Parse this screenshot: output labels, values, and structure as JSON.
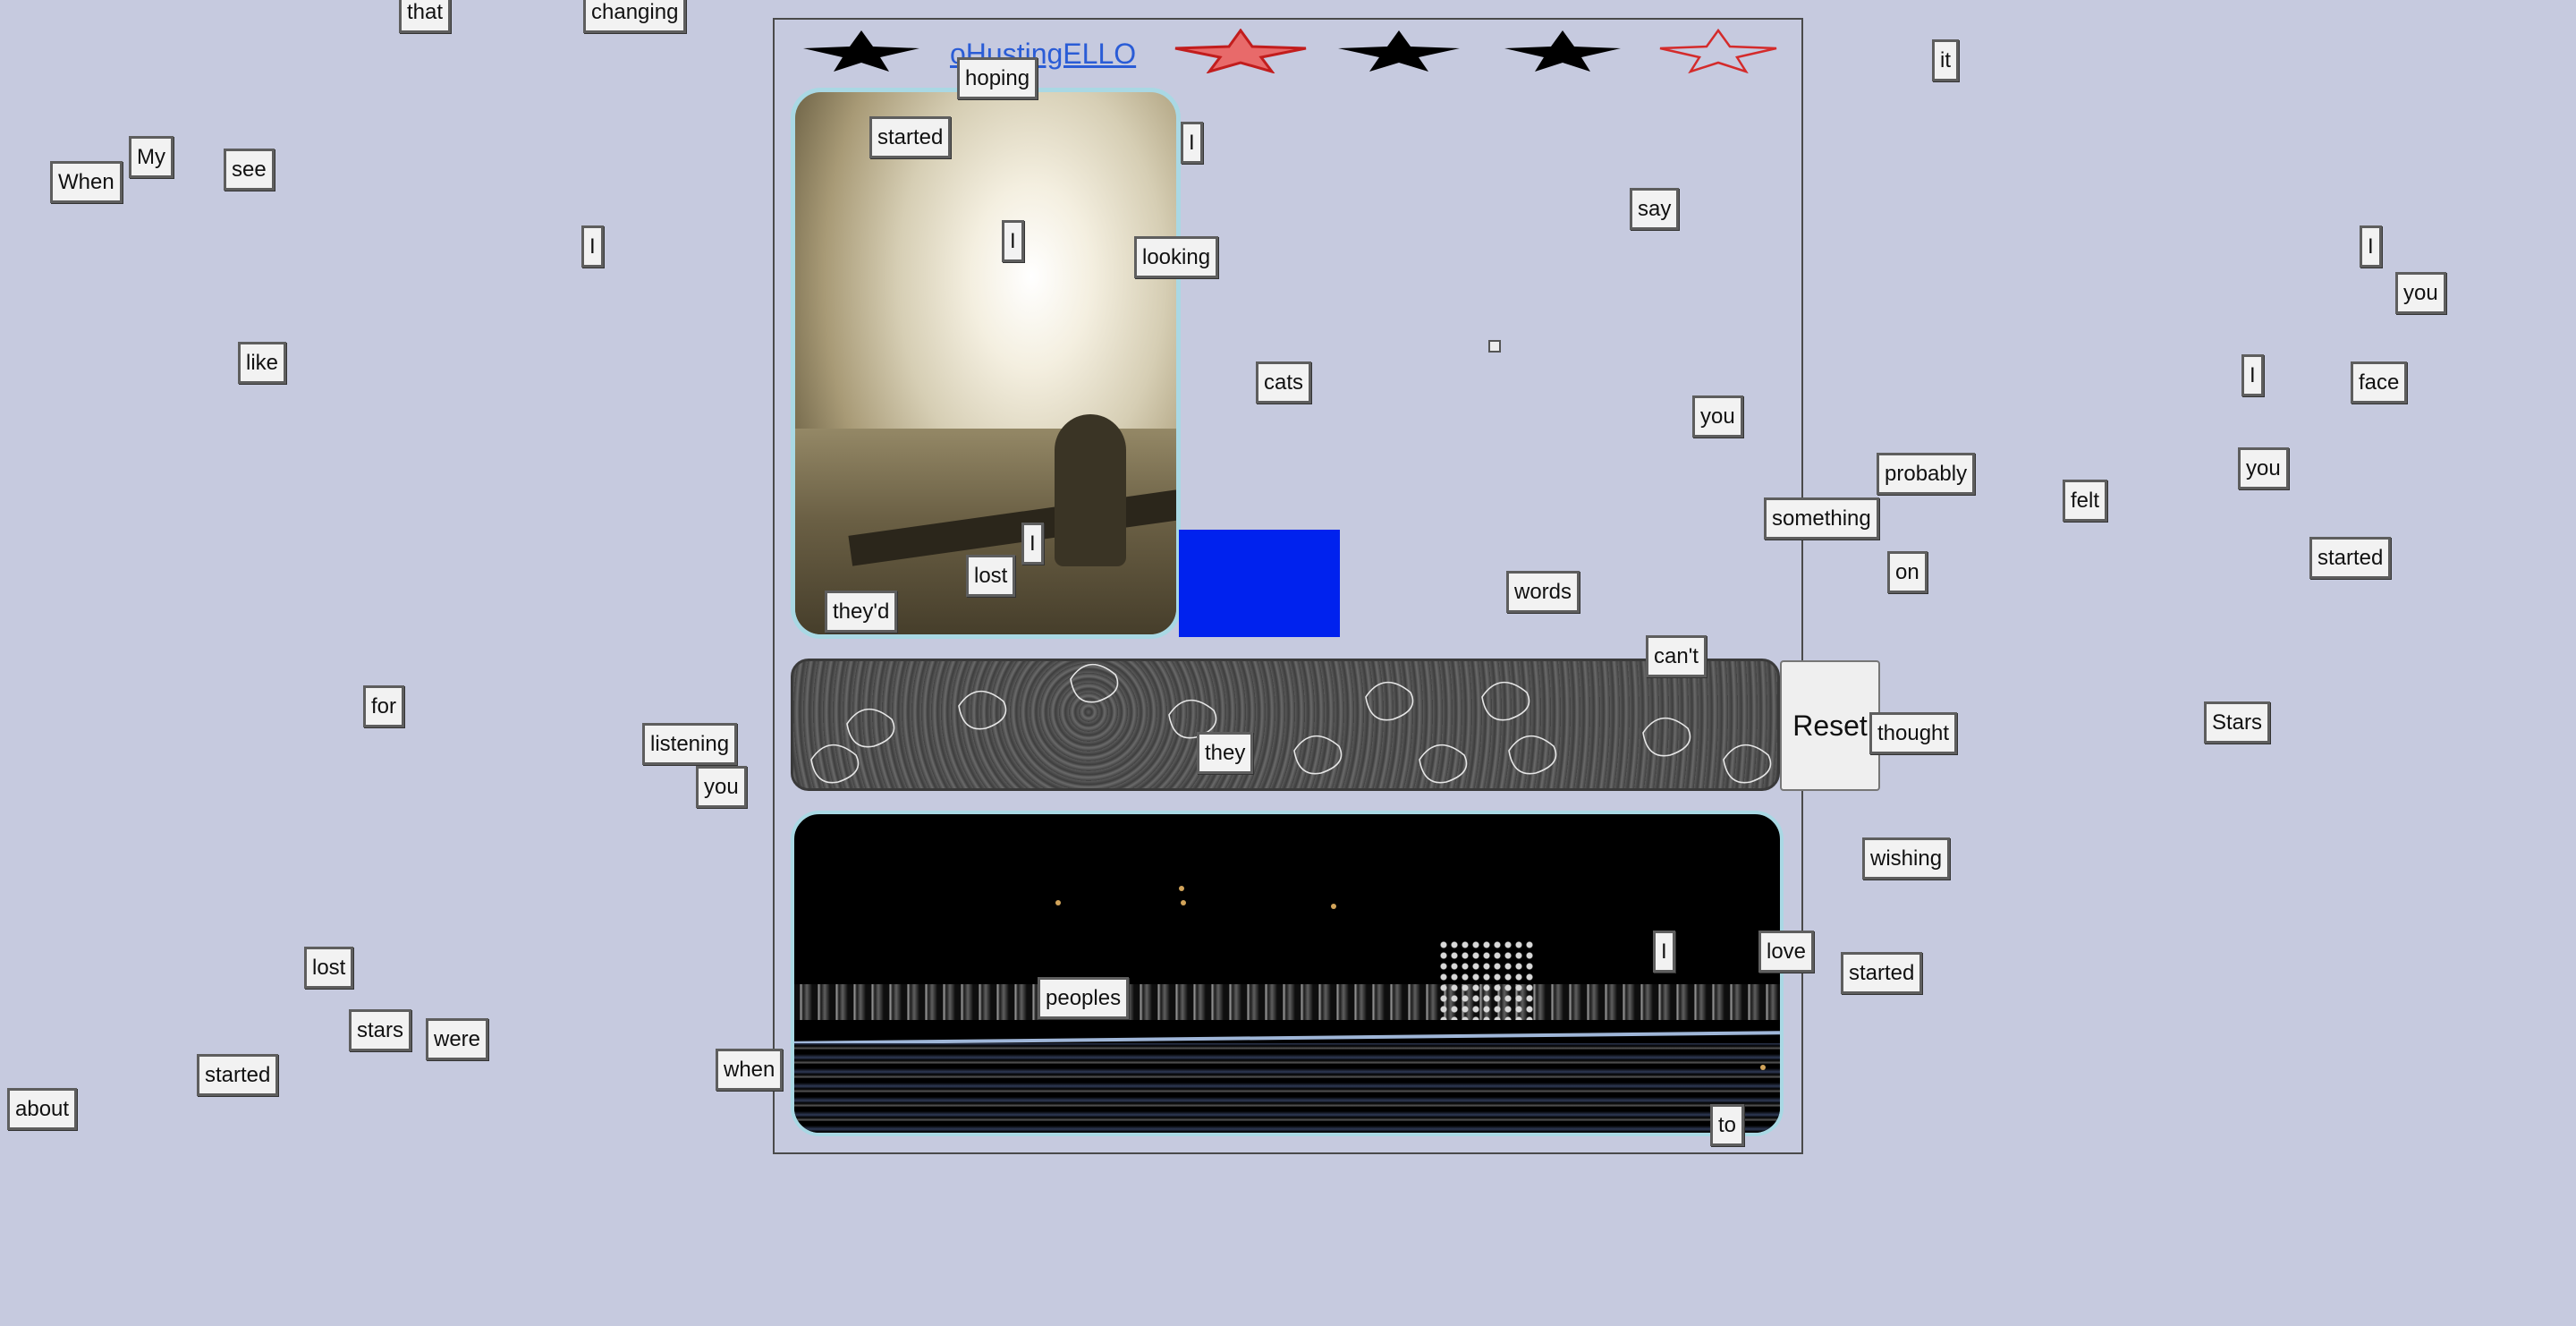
{
  "header": {
    "title_link": "oHustingELLO"
  },
  "reset_button": {
    "label": "Reset"
  },
  "colors": {
    "background": "#c6cadf",
    "link": "#2a5cd6",
    "blue_block": "#0022ee",
    "panel_border": "#a9d8e4"
  },
  "words": [
    "that",
    "changing",
    "My",
    "When",
    "see",
    "I",
    "like",
    "for",
    "listening",
    "you",
    "lost",
    "stars",
    "were",
    "started",
    "about",
    "when",
    "hoping",
    "started",
    "I",
    "I",
    "looking",
    "cats",
    "lost",
    "I",
    "they'd",
    "say",
    "you",
    "words",
    "can't",
    "they",
    "peoples",
    "I",
    "love",
    "to",
    "it",
    "probably",
    "something",
    "on",
    "thought",
    "wishing",
    "started",
    "felt",
    "I",
    "you",
    "I",
    "face",
    "you",
    "started",
    "Stars"
  ]
}
